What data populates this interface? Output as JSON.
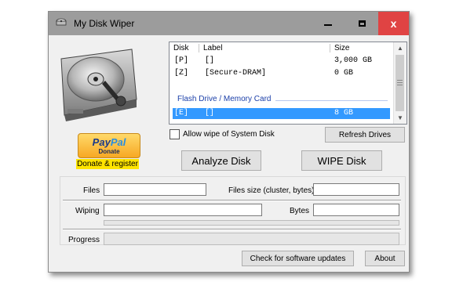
{
  "window": {
    "title": "My Disk Wiper",
    "minimize_glyph": "",
    "maximize_glyph": "",
    "close_glyph": "x"
  },
  "disk_list": {
    "headers": {
      "disk": "Disk",
      "label": "Label",
      "size": "Size"
    },
    "rows": [
      {
        "disk": "[P]",
        "label": "[]",
        "size": "3,000 GB",
        "selected": false
      },
      {
        "disk": "[Z]",
        "label": "[Secure-DRAM]",
        "size": "0 GB",
        "selected": false
      }
    ],
    "group_header": "Flash Drive / Memory Card",
    "group_rows": [
      {
        "disk": "[E]",
        "label": "[]",
        "size": "8 GB",
        "selected": true
      }
    ]
  },
  "donate": {
    "paypal_word_pay": "Pay",
    "paypal_word_pal": "Pal",
    "paypal_sub": "Donate",
    "label": "Donate & register"
  },
  "options": {
    "allow_system_wipe_label": "Allow wipe of System Disk",
    "allow_system_wipe_checked": false
  },
  "buttons": {
    "refresh": "Refresh Drives",
    "analyze": "Analyze Disk",
    "wipe": "WIPE Disk",
    "check_updates": "Check for software updates",
    "about": "About"
  },
  "fields": {
    "files_label": "Files",
    "files_value": "",
    "files_size_label": "Files size (cluster, bytes)",
    "files_size_value": "",
    "wiping_label": "Wiping",
    "wiping_value": "",
    "bytes_label": "Bytes",
    "bytes_value": "",
    "progress_label": "Progress",
    "progress_value": 0
  },
  "icons": {
    "app": "disk-app-icon",
    "hard_drive": "hard-drive-icon",
    "scroll_up": "chevron-up-icon",
    "scroll_down": "chevron-down-icon"
  }
}
